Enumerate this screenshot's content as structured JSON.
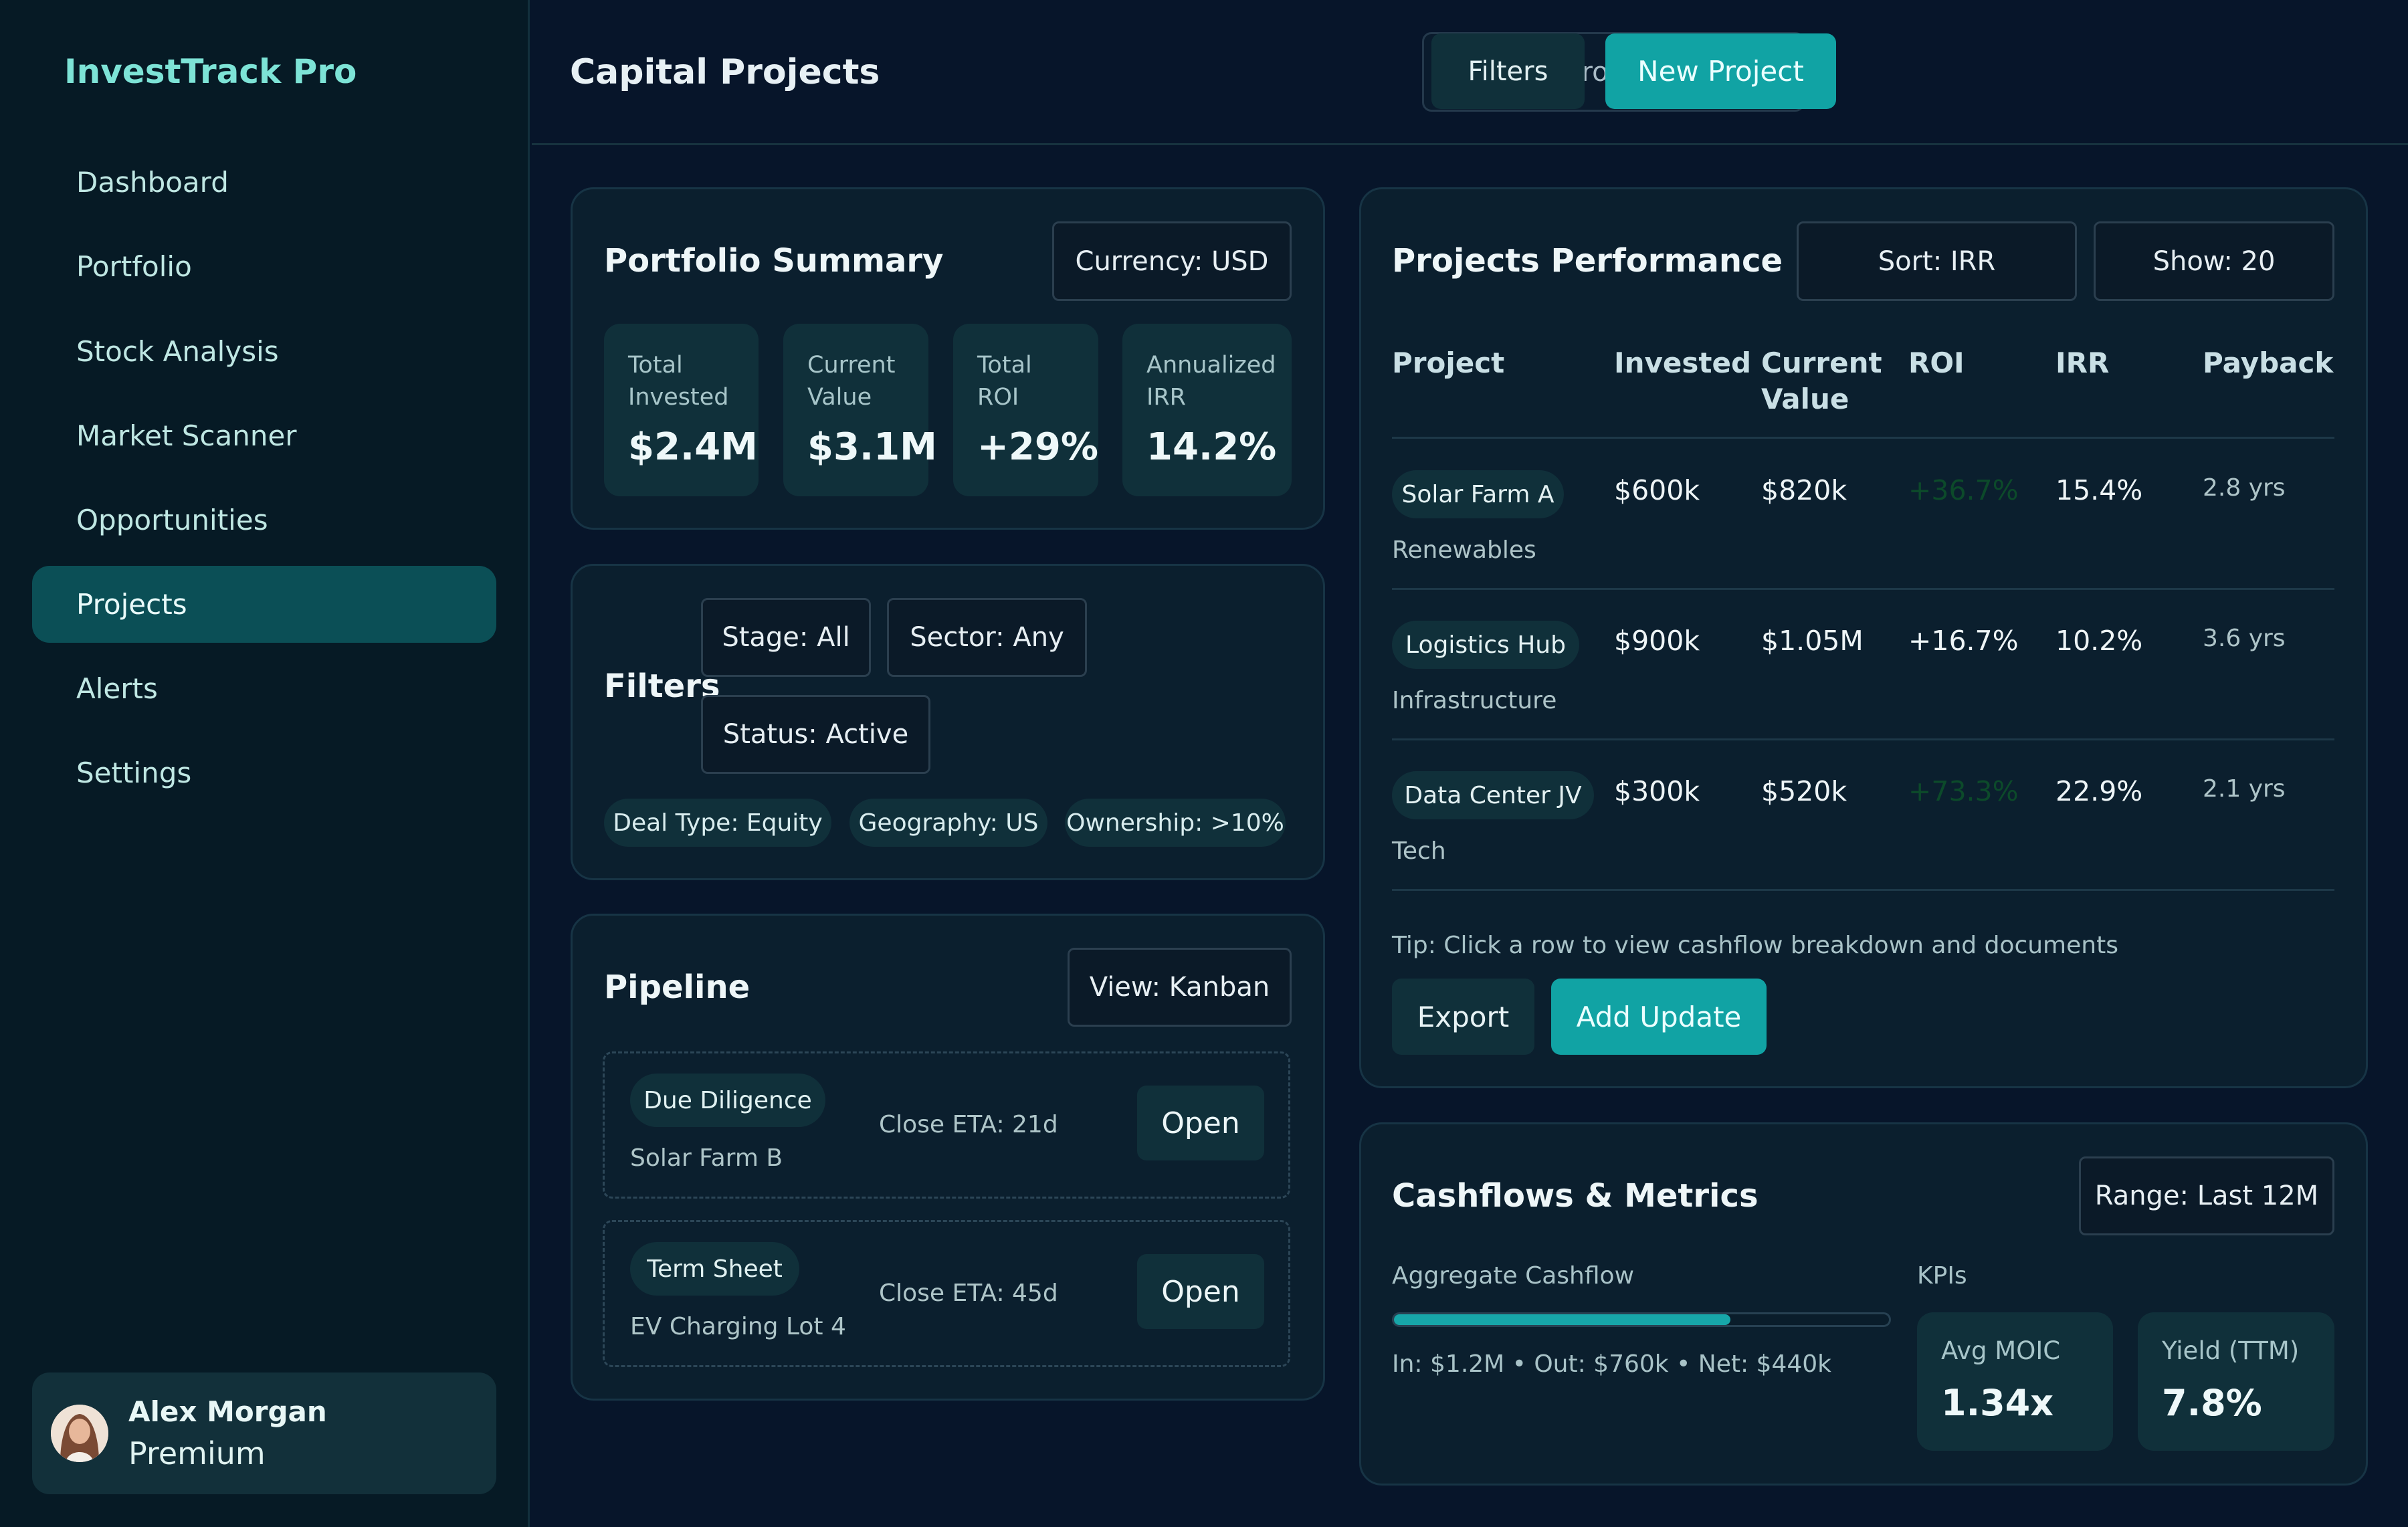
{
  "app": {
    "name": "InvestTrack Pro"
  },
  "sidebar": {
    "items": [
      {
        "label": "Dashboard",
        "active": false
      },
      {
        "label": "Portfolio",
        "active": false
      },
      {
        "label": "Stock Analysis",
        "active": false
      },
      {
        "label": "Market Scanner",
        "active": false
      },
      {
        "label": "Opportunities",
        "active": false
      },
      {
        "label": "Projects",
        "active": true
      },
      {
        "label": "Alerts",
        "active": false
      },
      {
        "label": "Settings",
        "active": false
      }
    ]
  },
  "user": {
    "name": "Alex Morgan",
    "plan": "Premium"
  },
  "header": {
    "title": "Capital Projects",
    "search_placeholder": "Search projects...",
    "filters_label": "Filters",
    "new_project_label": "New Project"
  },
  "portfolio_summary": {
    "title": "Portfolio Summary",
    "currency": "Currency: USD",
    "stats": [
      {
        "label_1": "Total",
        "label_2": "Invested",
        "value": "$2.4M"
      },
      {
        "label_1": "Current",
        "label_2": "Value",
        "value": "$3.1M"
      },
      {
        "label_1": "Total",
        "label_2": "ROI",
        "value": "+29%"
      },
      {
        "label_1": "Annualized",
        "label_2": "IRR",
        "value": "14.2%"
      }
    ]
  },
  "filters": {
    "title": "Filters",
    "selects": [
      "Stage: All",
      "Sector: Any",
      "Status: Active"
    ],
    "chips": [
      "Deal Type: Equity",
      "Geography: US",
      "Ownership: >10%"
    ]
  },
  "pipeline": {
    "title": "Pipeline",
    "view": "View: Kanban",
    "items": [
      {
        "stage": "Due Diligence",
        "project": "Solar Farm B",
        "eta": "Close ETA: 21d",
        "action": "Open"
      },
      {
        "stage": "Term Sheet",
        "project": "EV Charging Lot 4",
        "eta": "Close ETA: 45d",
        "action": "Open"
      }
    ]
  },
  "performance": {
    "title": "Projects Performance",
    "sort": "Sort: IRR",
    "show": "Show: 20",
    "columns": {
      "project": "Project",
      "invested": "Invested",
      "current_1": "Current",
      "current_2": "Value",
      "roi": "ROI",
      "irr": "IRR",
      "payback": "Payback"
    },
    "rows": [
      {
        "name": "Solar Farm A",
        "sector": "Renewables",
        "invested": "$600k",
        "current": "$820k",
        "roi": "+36.7%",
        "irr": "15.4%",
        "payback": "2.8 yrs"
      },
      {
        "name": "Logistics Hub",
        "sector": "Infrastructure",
        "invested": "$900k",
        "current": "$1.05M",
        "roi": "+16.7%",
        "irr": "10.2%",
        "payback": "3.6 yrs"
      },
      {
        "name": "Data Center JV",
        "sector": "Tech",
        "invested": "$300k",
        "current": "$520k",
        "roi": "+73.3%",
        "irr": "22.9%",
        "payback": "2.1 yrs"
      }
    ],
    "tip": "Tip: Click a row to view cashflow breakdown and documents",
    "export_label": "Export",
    "update_label": "Add Update"
  },
  "cashflows": {
    "title": "Cashflows & Metrics",
    "range": "Range: Last 12M",
    "aggregate_label": "Aggregate Cashflow",
    "aggregate_fill": 0.68,
    "summary": "In: $1.2M • Out: $760k • Net: $440k",
    "kpis_label": "KPIs",
    "kpis": [
      {
        "label": "Avg MOIC",
        "value": "1.34x"
      },
      {
        "label": "Yield (TTM)",
        "value": "7.8%"
      }
    ]
  },
  "colors": {
    "accent": "#11a3a4",
    "background": "#07152a",
    "sidebar": "#061a25",
    "brand": "#7de3d6"
  }
}
